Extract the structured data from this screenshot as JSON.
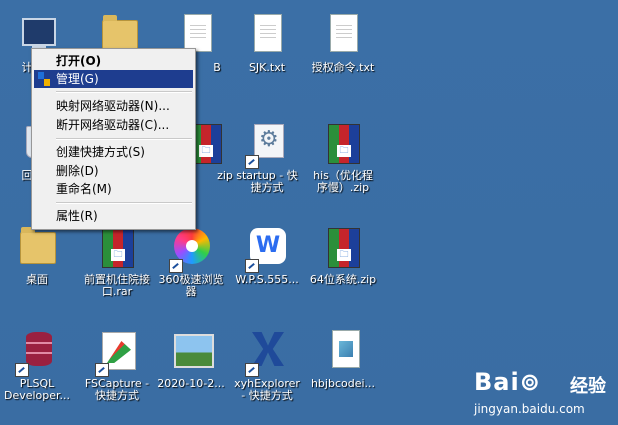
{
  "desktop": {
    "icons": [
      {
        "id": "computer",
        "label": "计"
      },
      {
        "id": "folder-top",
        "label": ""
      },
      {
        "id": "doc-b",
        "label": "B"
      },
      {
        "id": "sjk",
        "label": "SJK.txt"
      },
      {
        "id": "auth",
        "label": "授权命令.txt"
      },
      {
        "id": "recycle",
        "label": "回"
      },
      {
        "id": "zip-hidden",
        "label": "zip"
      },
      {
        "id": "startup",
        "label": "startup - 快\n捷方式"
      },
      {
        "id": "his",
        "label": "his（优化程\n序慢）.zip"
      },
      {
        "id": "desktop-folder",
        "label": "桌面"
      },
      {
        "id": "front",
        "label": "前置机住院接\n口.rar"
      },
      {
        "id": "browser360",
        "label": "360极速浏览\n器"
      },
      {
        "id": "wps",
        "label": "W.P.S.555..."
      },
      {
        "id": "sys64",
        "label": "64位系统.zip"
      },
      {
        "id": "plsql",
        "label": "PLSQL\nDeveloper..."
      },
      {
        "id": "fscapture",
        "label": "FSCapture -\n快捷方式"
      },
      {
        "id": "photo",
        "label": "2020-10-2..."
      },
      {
        "id": "xyh",
        "label": "xyhExplorer\n- 快捷方式"
      },
      {
        "id": "hbj",
        "label": "hbjbcodei..."
      }
    ]
  },
  "context_menu": {
    "items": [
      {
        "label": "打开(O)"
      },
      {
        "label": "管理(G)"
      },
      {
        "label": "映射网络驱动器(N)..."
      },
      {
        "label": "断开网络驱动器(C)..."
      },
      {
        "label": "创建快捷方式(S)"
      },
      {
        "label": "删除(D)"
      },
      {
        "label": "重命名(M)"
      },
      {
        "label": "属性(R)"
      }
    ],
    "highlighted_index": 1
  },
  "watermark": {
    "logo": "Bai⊚",
    "cn": "经验",
    "url": "jingyan.baidu.com"
  },
  "colors": {
    "desktop_bg": "#3a6ea5",
    "menu_bg": "#f0f0f0",
    "menu_highlight": "#1e3d8f"
  }
}
